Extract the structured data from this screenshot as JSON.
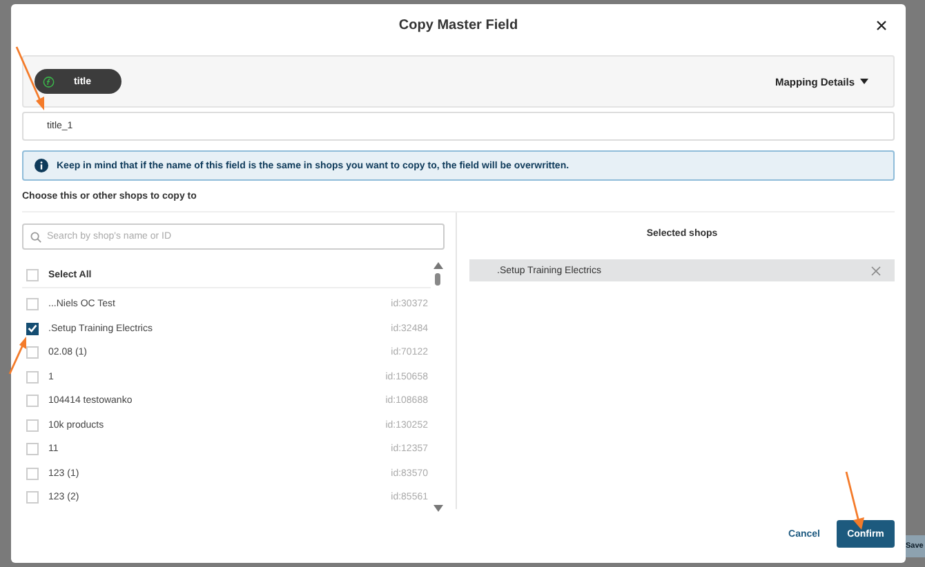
{
  "dialog": {
    "title": "Copy Master Field",
    "field_chip": {
      "label": "title"
    },
    "mapping_details": "Mapping Details",
    "name_input": {
      "value": "title_1"
    },
    "info": "Keep in mind that if the name of this field is the same in shops you want to copy to, the field will be overwritten.",
    "section_title": "Choose this or other shops to copy to",
    "search": {
      "placeholder": "Search by shop's name or ID"
    },
    "select_all": {
      "label": "Select All",
      "checked": false
    },
    "shops": [
      {
        "name": "...Niels OC Test",
        "id": "id:30372",
        "checked": false
      },
      {
        "name": ".Setup Training Electrics",
        "id": "id:32484",
        "checked": true
      },
      {
        "name": "02.08 (1)",
        "id": "id:70122",
        "checked": false
      },
      {
        "name": "1",
        "id": "id:150658",
        "checked": false
      },
      {
        "name": "104414 testowanko",
        "id": "id:108688",
        "checked": false
      },
      {
        "name": "10k products",
        "id": "id:130252",
        "checked": false
      },
      {
        "name": "11",
        "id": "id:12357",
        "checked": false
      },
      {
        "name": "123 (1)",
        "id": "id:83570",
        "checked": false
      },
      {
        "name": "123 (2)",
        "id": "id:85561",
        "checked": false
      }
    ],
    "selected_heading": "Selected shops",
    "selected_shops": [
      ".Setup Training Electrics"
    ],
    "cancel": "Cancel",
    "confirm": "Confirm"
  },
  "background": {
    "save_button": "Save"
  }
}
